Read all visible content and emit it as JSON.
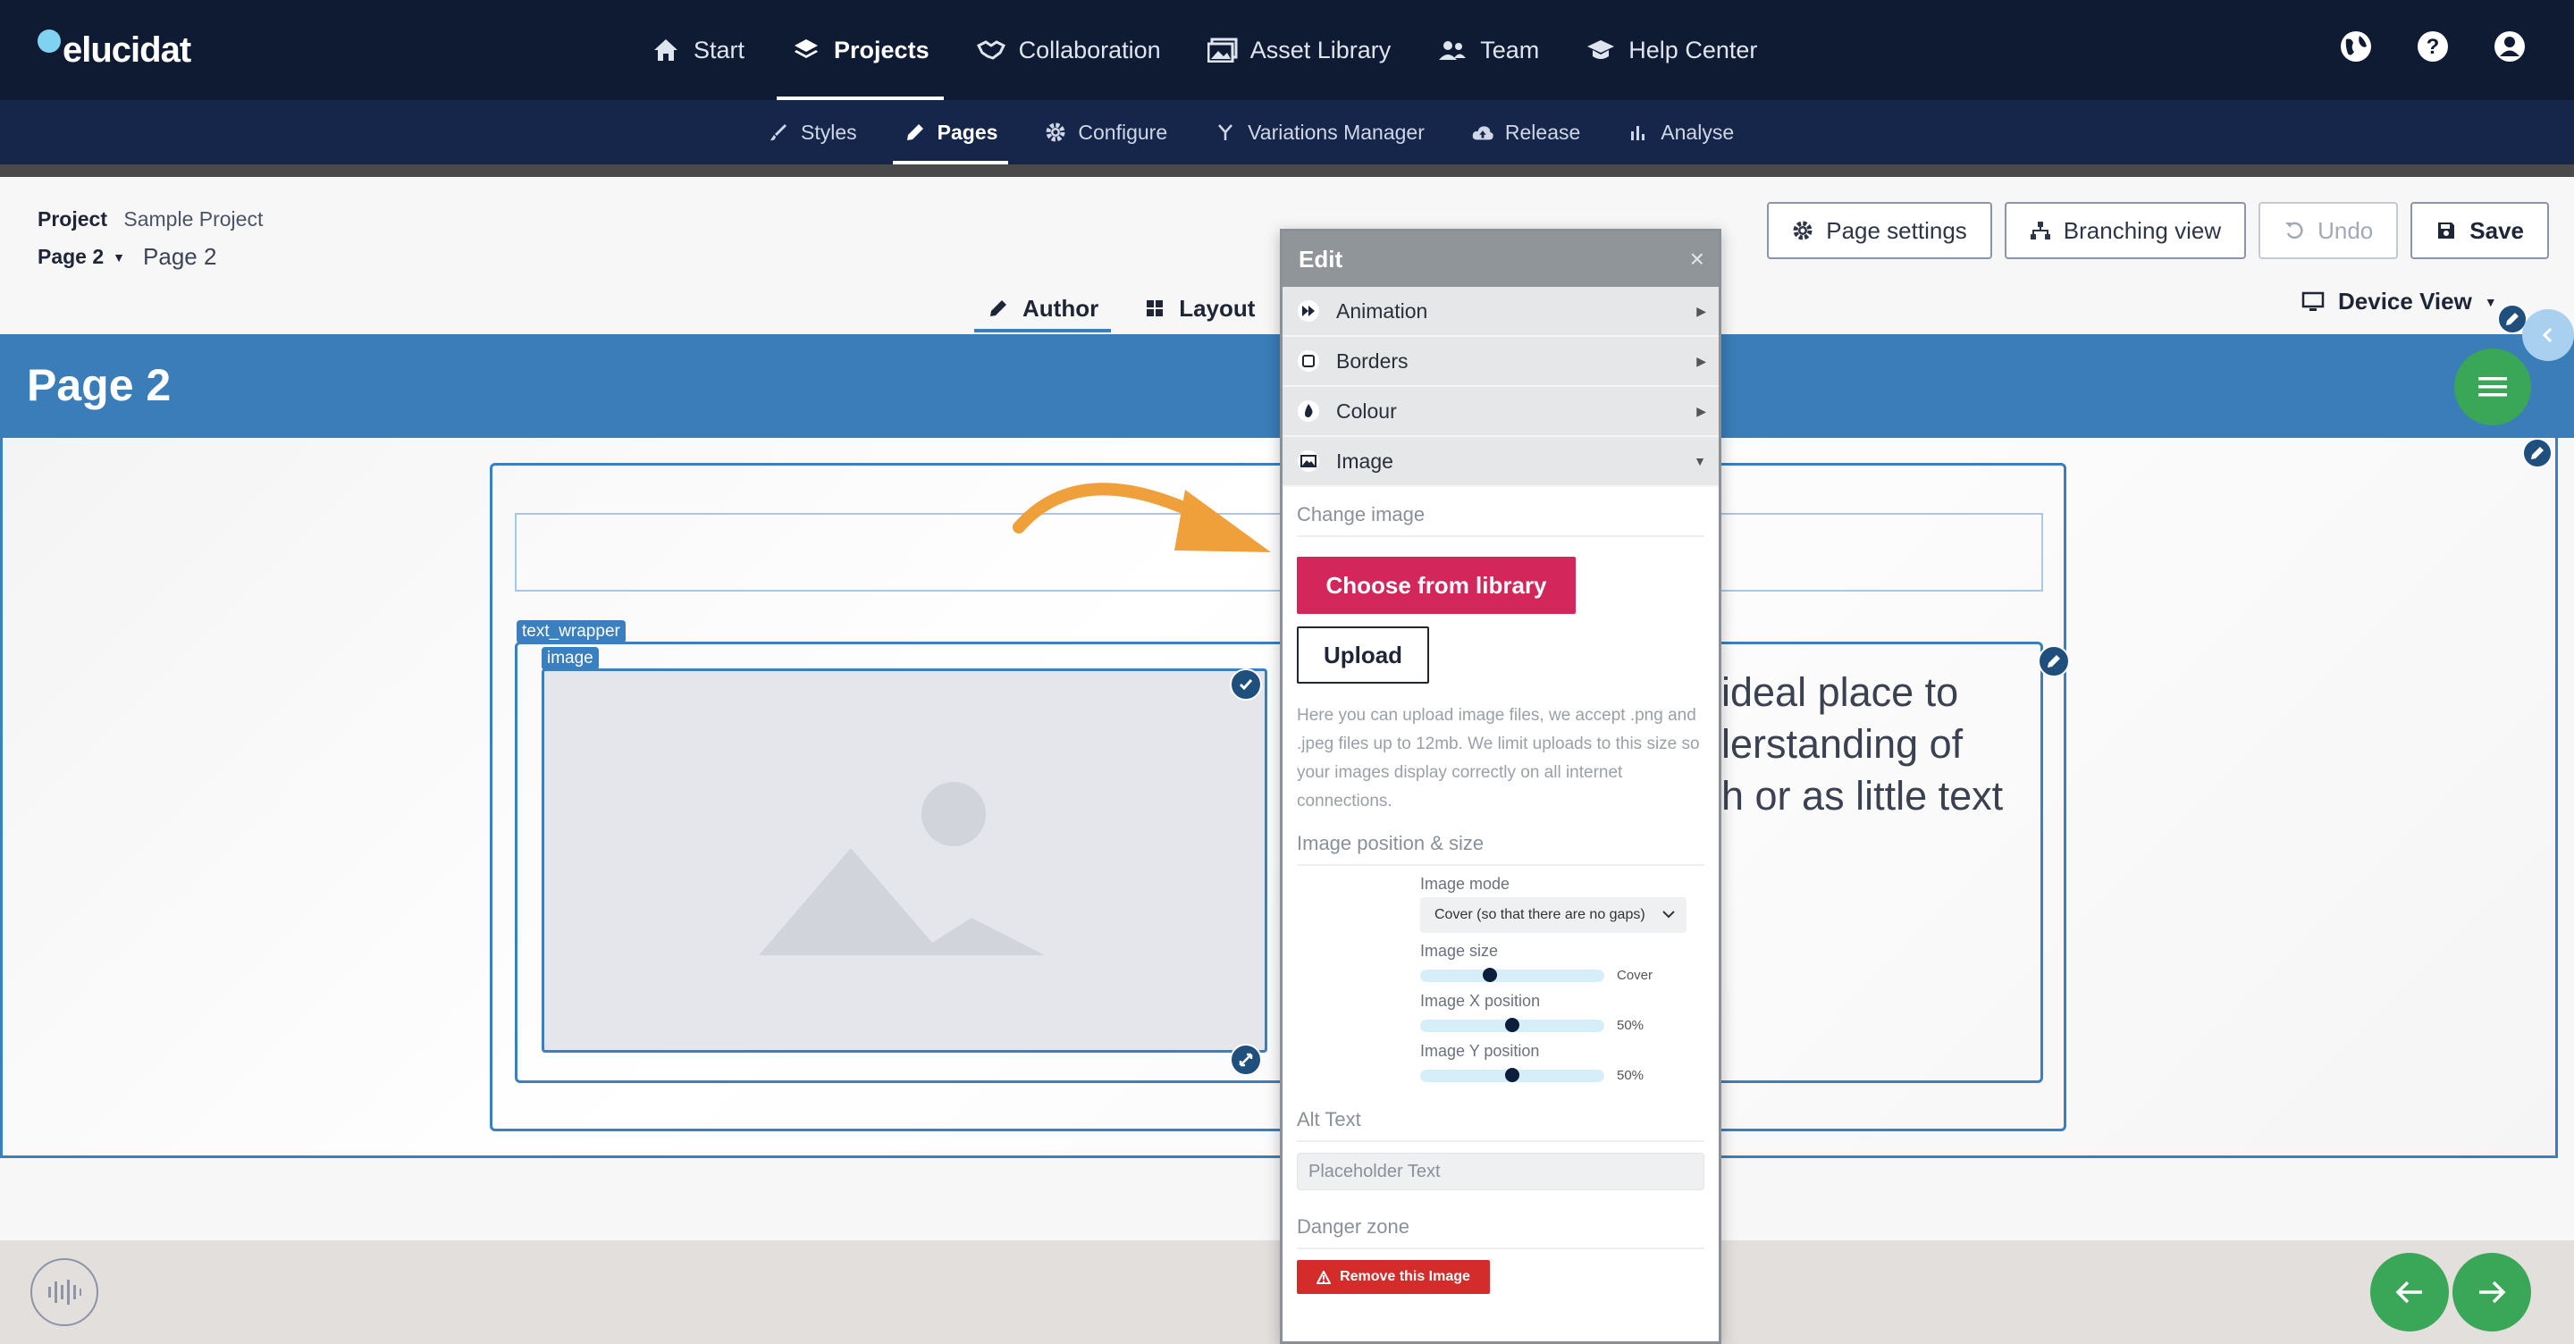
{
  "app": {
    "logo_text": "elucidat"
  },
  "main_nav": [
    {
      "label": "Start",
      "icon": "home-icon"
    },
    {
      "label": "Projects",
      "icon": "layers-icon",
      "active": true
    },
    {
      "label": "Collaboration",
      "icon": "handshake-icon"
    },
    {
      "label": "Asset Library",
      "icon": "images-icon"
    },
    {
      "label": "Team",
      "icon": "users-icon"
    },
    {
      "label": "Help Center",
      "icon": "graduation-cap-icon"
    }
  ],
  "top_icons": [
    "globe-icon",
    "help-icon",
    "user-icon"
  ],
  "sub_nav": [
    {
      "label": "Styles",
      "icon": "brush-icon"
    },
    {
      "label": "Pages",
      "icon": "pencil-icon",
      "active": true
    },
    {
      "label": "Configure",
      "icon": "gear-icon"
    },
    {
      "label": "Variations Manager",
      "icon": "branch-icon"
    },
    {
      "label": "Release",
      "icon": "cloud-upload-icon"
    },
    {
      "label": "Analyse",
      "icon": "bar-chart-icon"
    }
  ],
  "project": {
    "label": "Project",
    "name": "Sample Project",
    "page_select": "Page 2",
    "page_name": "Page 2"
  },
  "mode_tabs": [
    {
      "label": "Author",
      "active": true
    },
    {
      "label": "Layout"
    }
  ],
  "toolbar": {
    "page_settings": "Page settings",
    "branching_view": "Branching view",
    "undo": "Undo",
    "save": "Save",
    "device_view": "Device View"
  },
  "page": {
    "title": "Page 2",
    "body_text": [
      "ideal place to",
      "lerstanding of",
      "h or as little text"
    ],
    "tags": {
      "wrapper": "text_wrapper",
      "image": "image"
    }
  },
  "edit_panel": {
    "title": "Edit",
    "close": "×",
    "accordions": [
      {
        "label": "Animation",
        "icon": "fast-forward-icon"
      },
      {
        "label": "Borders",
        "icon": "square-icon"
      },
      {
        "label": "Colour",
        "icon": "droplet-icon"
      },
      {
        "label": "Image",
        "icon": "image-icon",
        "open": true
      }
    ],
    "change_image": "Change image",
    "choose_library": "Choose from library",
    "upload": "Upload",
    "help_text": "Here you can upload image files, we accept .png and .jpeg files up to 12mb. We limit uploads to this size so your images display correctly on all internet connections.",
    "position_section": "Image position & size",
    "image_mode_label": "Image mode",
    "image_mode_value": "Cover (so that there are no gaps)",
    "image_size_label": "Image size",
    "image_size_value": "Cover",
    "image_size_level": 0.37,
    "image_x_label": "Image X position",
    "image_x_value": "50%",
    "image_x_level": 0.5,
    "image_y_label": "Image Y position",
    "image_y_value": "50%",
    "image_y_level": 0.5,
    "alt_section": "Alt Text",
    "alt_placeholder": "Placeholder Text",
    "danger_section": "Danger zone",
    "remove": "Remove this Image"
  },
  "colors": {
    "topbar": "#0f1a33",
    "subbar": "#15264a",
    "accent_blue": "#3a7fbf",
    "library_button": "#d3265a",
    "danger": "#d42b2b",
    "green": "#3aa657",
    "arrow": "#f0a03a"
  }
}
